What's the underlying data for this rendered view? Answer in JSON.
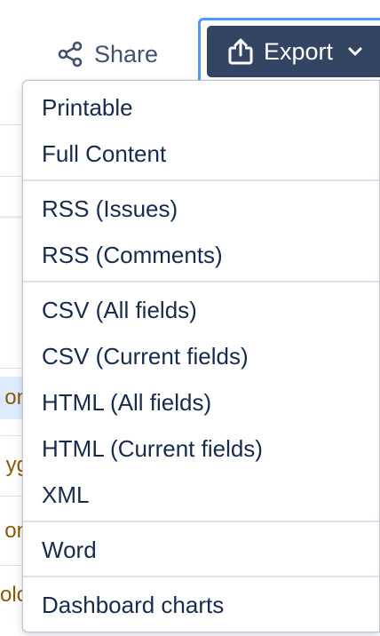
{
  "toolbar": {
    "share_label": "Share",
    "export_label": "Export"
  },
  "background": {
    "row_fragments": [
      "on",
      "yg",
      "on",
      "olo"
    ]
  },
  "export_menu": {
    "groups": [
      {
        "items": [
          "Printable",
          "Full Content"
        ]
      },
      {
        "items": [
          "RSS (Issues)",
          "RSS (Comments)"
        ]
      },
      {
        "items": [
          "CSV (All fields)",
          "CSV (Current fields)",
          "HTML (All fields)",
          "HTML (Current fields)",
          "XML"
        ]
      },
      {
        "items": [
          "Word"
        ]
      },
      {
        "items": [
          "Dashboard charts"
        ]
      }
    ]
  },
  "colors": {
    "export_button_bg": "#344563",
    "focus_ring": "#4c9aff",
    "menu_text": "#172b4d",
    "share_text": "#42526e",
    "row_fragment_text": "#8b5a00",
    "selected_row_bg": "#deebff"
  },
  "icons": {
    "share": "share-icon",
    "export": "upload-icon",
    "dropdown": "chevron-down-icon"
  }
}
